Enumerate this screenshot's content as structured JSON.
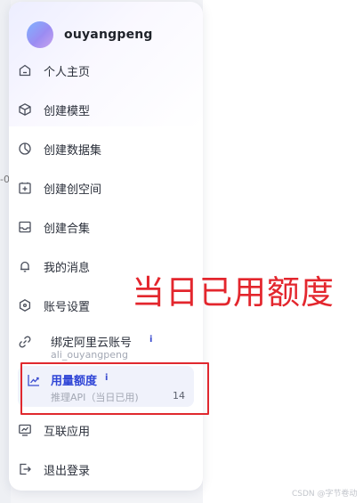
{
  "user": {
    "name": "ouyangpeng"
  },
  "menu": {
    "items": [
      {
        "label": "个人主页",
        "icon": "home-icon"
      },
      {
        "label": "创建模型",
        "icon": "cube-icon"
      },
      {
        "label": "创建数据集",
        "icon": "pie-chart-icon"
      },
      {
        "label": "创建创空间",
        "icon": "space-plus-icon"
      },
      {
        "label": "创建合集",
        "icon": "inbox-icon"
      },
      {
        "label": "我的消息",
        "icon": "bell-icon"
      },
      {
        "label": "账号设置",
        "icon": "settings-icon"
      }
    ],
    "bind_aliyun": {
      "label": "绑定阿里云账号",
      "info": "i",
      "sub": "ali_ouyangpeng",
      "icon": "link-icon"
    },
    "usage": {
      "label": "用量额度",
      "info": "i",
      "sub": "推理API（当日已用)",
      "count": "14",
      "icon": "trend-chart-icon"
    },
    "bottom_items": [
      {
        "label": "互联应用",
        "icon": "monitor-chart-icon"
      },
      {
        "label": "退出登录",
        "icon": "logout-icon"
      }
    ]
  },
  "annotation": {
    "text": "当日已用额度",
    "color": "#e3262d"
  },
  "watermark": "CSDN @字节卷动",
  "background": {
    "edge_fragment": "-0"
  },
  "colors": {
    "accent": "#2f45d6",
    "highlight_bg": "#f0f2fb",
    "annotation": "#e3262d"
  }
}
